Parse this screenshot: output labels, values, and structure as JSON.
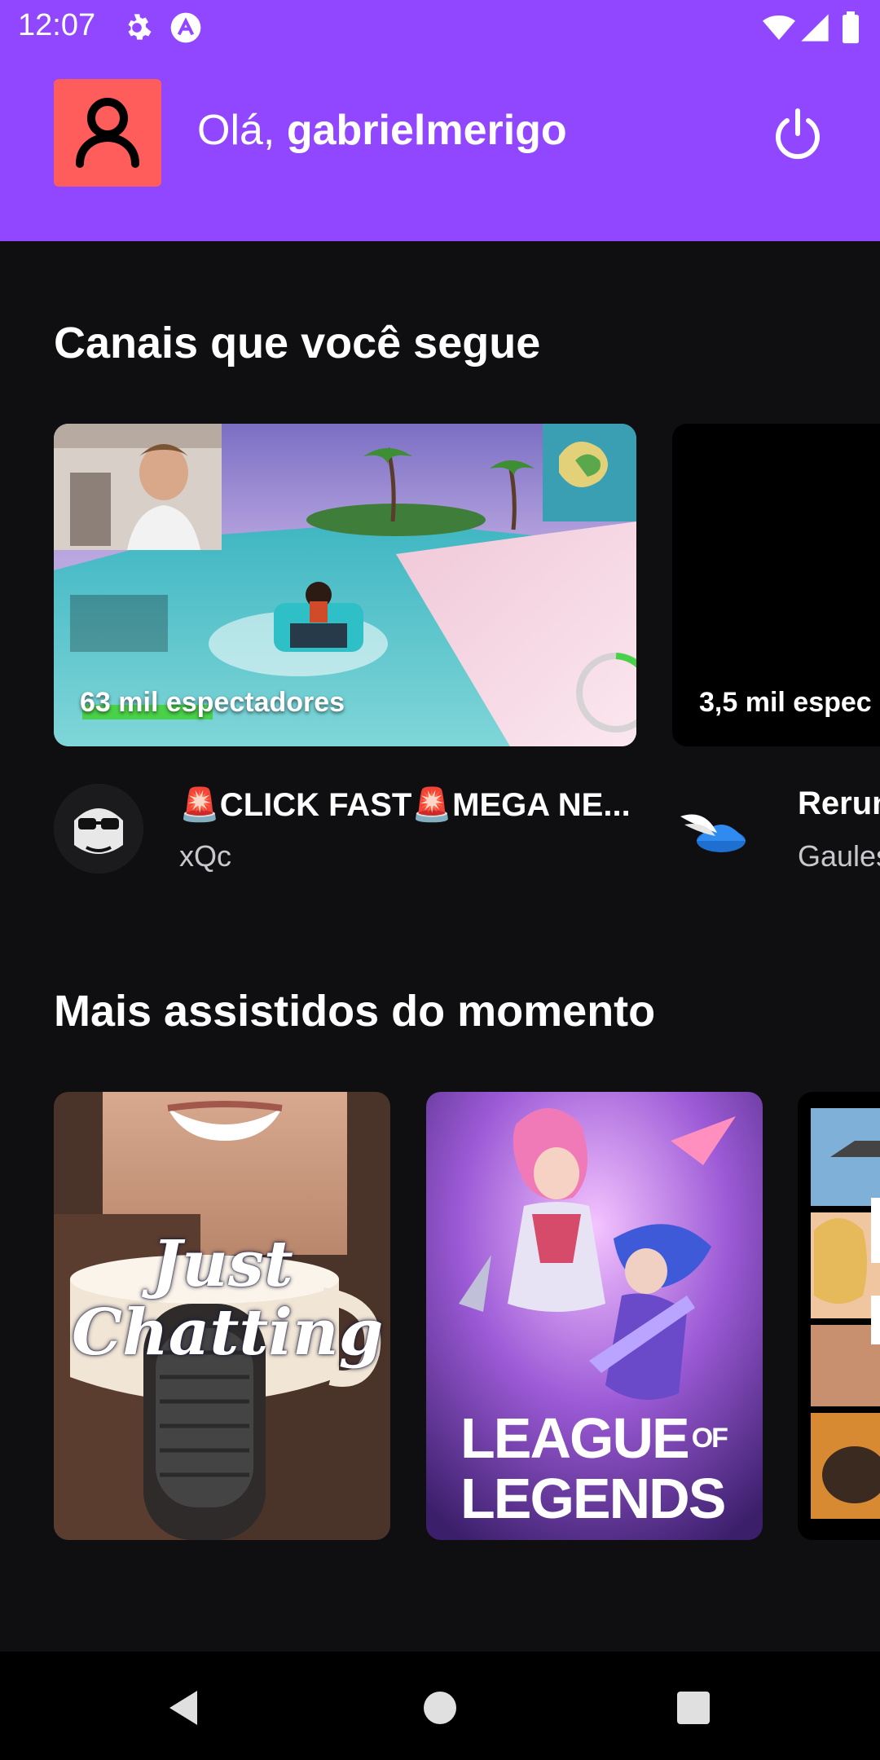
{
  "status_bar": {
    "time": "12:07",
    "icons": [
      "gear-icon",
      "app-logo-icon",
      "wifi-icon",
      "signal-icon",
      "battery-icon"
    ]
  },
  "header": {
    "greeting_prefix": "Olá, ",
    "username": "gabrielmerigo",
    "avatar_icon": "user-icon",
    "logout_icon": "power-icon"
  },
  "followed": {
    "section_title": "Canais que você segue",
    "streams": [
      {
        "viewers": "63 mil espectadores",
        "title": "🚨CLICK FAST🚨MEGA NE...",
        "channel": "xQc"
      },
      {
        "viewers": "3,5 mil espec",
        "title": "Rerun",
        "channel": "Gaules"
      }
    ]
  },
  "top_categories": {
    "section_title": "Mais assistidos do momento",
    "categories": [
      {
        "line1": "Just",
        "line2": "Chatting"
      },
      {
        "line1": "LEAGUE",
        "line1b": "OF",
        "line2": "LEGENDS"
      },
      {
        "name": "Grand Theft Auto V"
      }
    ]
  },
  "colors": {
    "brand_purple": "#9147ff",
    "background": "#0f0f12",
    "avatar_red": "#ff5c5c"
  },
  "nav_bar": {
    "buttons": [
      "back-icon",
      "home-icon",
      "recents-icon"
    ]
  }
}
